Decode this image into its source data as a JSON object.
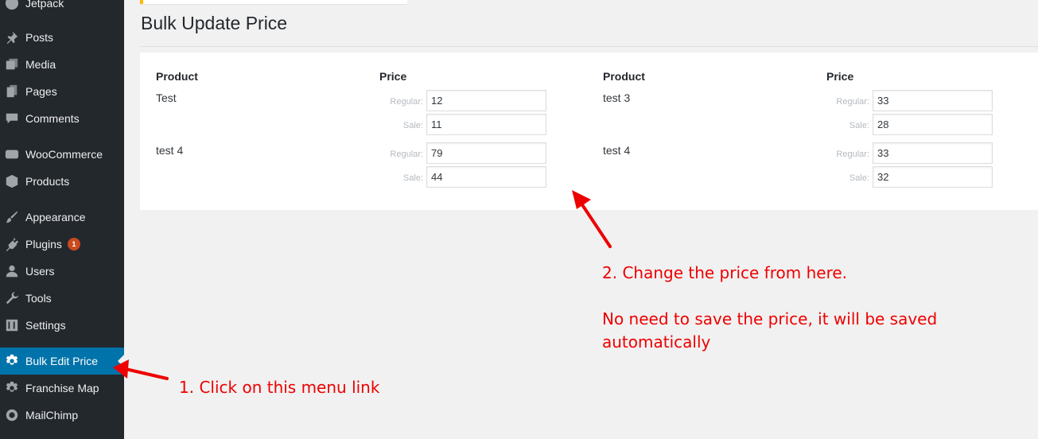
{
  "sidebar": {
    "items": [
      {
        "label": "Jetpack",
        "icon": "jetpack-icon"
      },
      {
        "label": "Posts",
        "icon": "pin-icon"
      },
      {
        "label": "Media",
        "icon": "media-icon"
      },
      {
        "label": "Pages",
        "icon": "pages-icon"
      },
      {
        "label": "Comments",
        "icon": "comment-icon"
      },
      {
        "label": "WooCommerce",
        "icon": "woocommerce-icon"
      },
      {
        "label": "Products",
        "icon": "box-icon"
      },
      {
        "label": "Appearance",
        "icon": "brush-icon"
      },
      {
        "label": "Plugins",
        "icon": "plug-icon",
        "badge": "1"
      },
      {
        "label": "Users",
        "icon": "user-icon"
      },
      {
        "label": "Tools",
        "icon": "wrench-icon"
      },
      {
        "label": "Settings",
        "icon": "settings-icon"
      },
      {
        "label": "Bulk Edit Price",
        "icon": "gear-icon",
        "active": true
      },
      {
        "label": "Franchise Map",
        "icon": "gear-icon"
      },
      {
        "label": "MailChimp",
        "icon": "mailchimp-icon"
      }
    ]
  },
  "page": {
    "title": "Bulk Update Price"
  },
  "table": {
    "headers": {
      "product": "Product",
      "price": "Price"
    },
    "regular_label": "Regular:",
    "sale_label": "Sale:",
    "rows": [
      {
        "name": "Test",
        "regular": "12",
        "sale": "11"
      },
      {
        "name": "test 3",
        "regular": "33",
        "sale": "28"
      },
      {
        "name": "test 4",
        "regular": "79",
        "sale": "44"
      },
      {
        "name": "test 4",
        "regular": "33",
        "sale": "32"
      }
    ]
  },
  "annotations": {
    "step1": "1. Click on this menu link",
    "step2_line1": "2. Change the price from here.",
    "step2_line2": "No need to save the price, it will be saved",
    "step2_line3": "automatically"
  },
  "colors": {
    "sidebar_bg": "#23282d",
    "active_bg": "#0073aa",
    "annotation_red": "#ee0000"
  }
}
